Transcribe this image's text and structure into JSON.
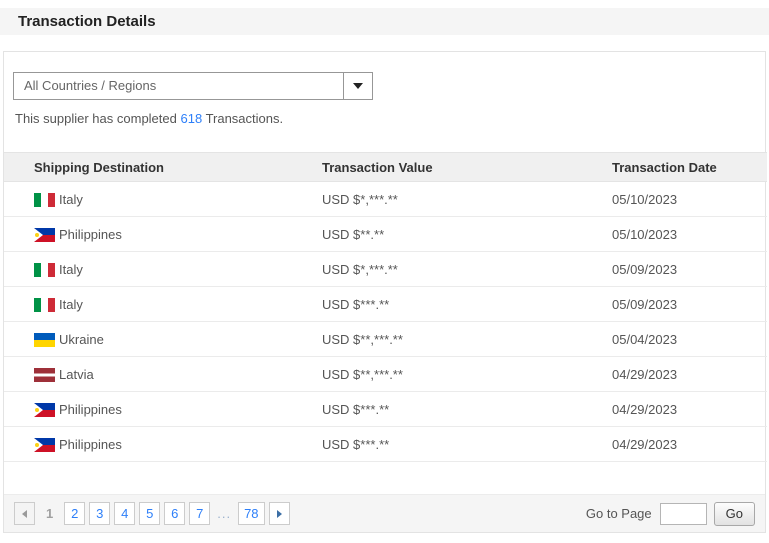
{
  "page": {
    "title": "Transaction Details"
  },
  "filter": {
    "selected_option": "All Countries / Regions"
  },
  "summary": {
    "prefix": "This supplier has completed ",
    "count": "618",
    "suffix": " Transactions."
  },
  "colors": {
    "link_blue": "#2d7ff9",
    "header_bg": "#f0f0f0",
    "bar_bg": "#f5f5f5"
  },
  "icons": {
    "dropdown": "caret-down-icon",
    "prev": "caret-left-icon",
    "next": "caret-right-icon"
  },
  "table": {
    "headers": [
      "Shipping Destination",
      "Transaction Value",
      "Transaction Date"
    ],
    "rows": [
      {
        "country": "Italy",
        "flag_class": "flag flag-it",
        "value": "USD $*,***.**",
        "date": "05/10/2023"
      },
      {
        "country": "Philippines",
        "flag_class": "flag flag-ph",
        "value": "USD $**.**",
        "date": "05/10/2023"
      },
      {
        "country": "Italy",
        "flag_class": "flag flag-it",
        "value": "USD $*,***.**",
        "date": "05/09/2023"
      },
      {
        "country": "Italy",
        "flag_class": "flag flag-it",
        "value": "USD $***.**",
        "date": "05/09/2023"
      },
      {
        "country": "Ukraine",
        "flag_class": "flag flag-ua",
        "value": "USD $**,***.**",
        "date": "05/04/2023"
      },
      {
        "country": "Latvia",
        "flag_class": "flag flag-lv",
        "value": "USD $**,***.**",
        "date": "04/29/2023"
      },
      {
        "country": "Philippines",
        "flag_class": "flag flag-ph",
        "value": "USD $***.**",
        "date": "04/29/2023"
      },
      {
        "country": "Philippines",
        "flag_class": "flag flag-ph",
        "value": "USD $***.**",
        "date": "04/29/2023"
      }
    ]
  },
  "pagination": {
    "current_page": "1",
    "pages": [
      "2",
      "3",
      "4",
      "5",
      "6",
      "7"
    ],
    "ellipsis": "...",
    "last_page": "78",
    "goto_label": "Go to Page",
    "go_button": "Go"
  }
}
